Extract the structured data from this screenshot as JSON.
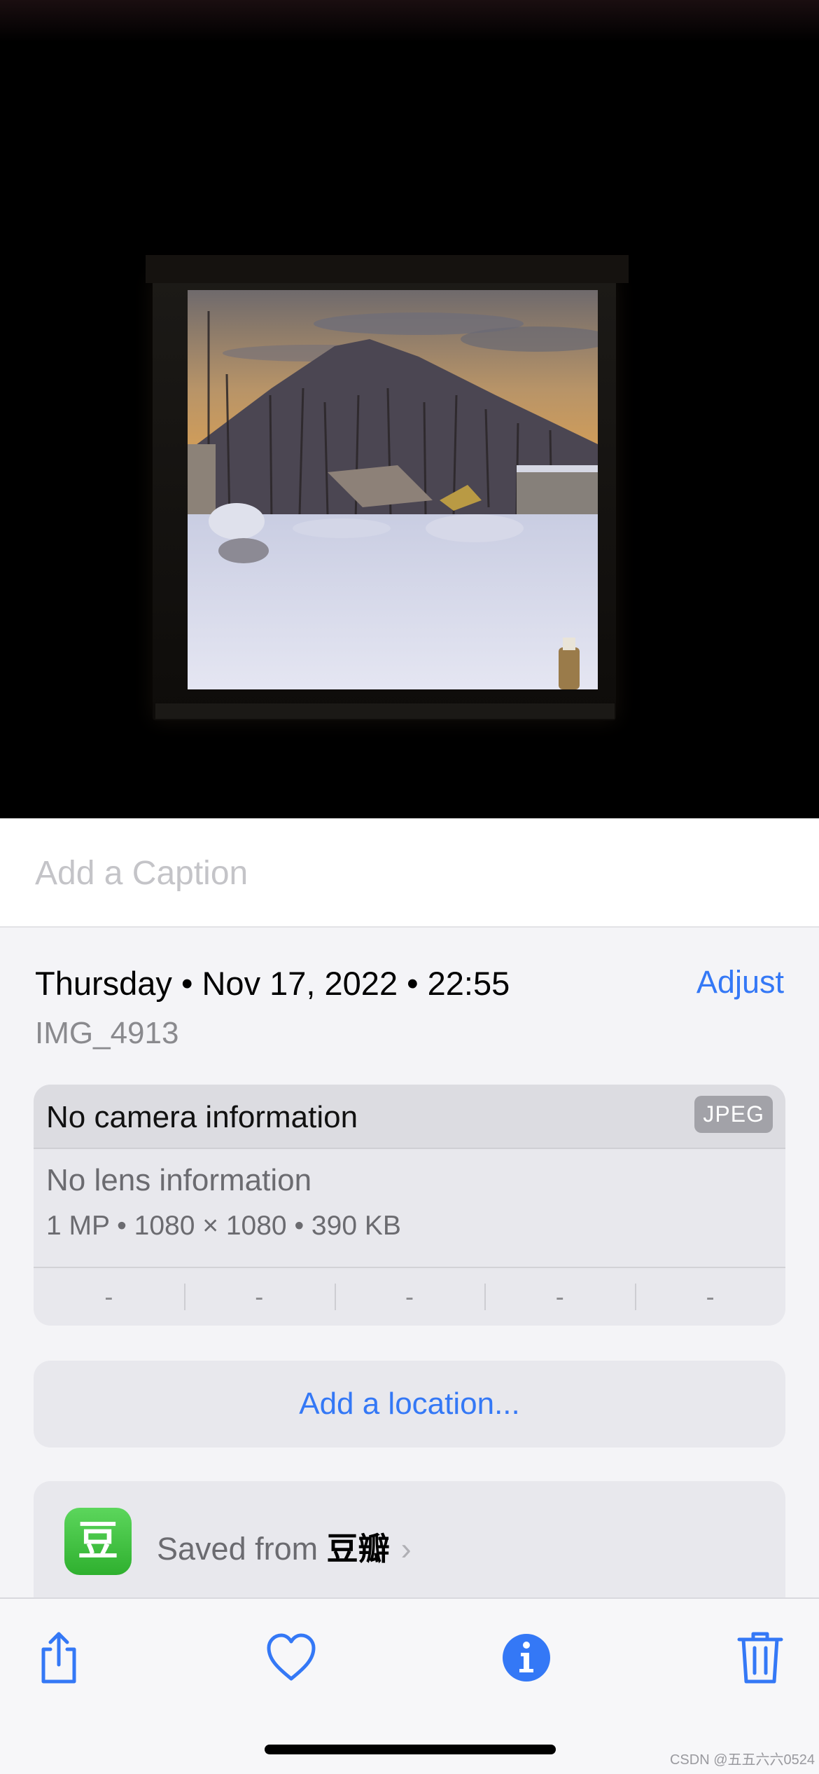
{
  "caption": {
    "placeholder": "Add a Caption"
  },
  "info": {
    "datetime": "Thursday • Nov 17, 2022 • 22:55",
    "adjust_label": "Adjust",
    "filename": "IMG_4913"
  },
  "metadata": {
    "camera": "No camera information",
    "format_badge": "JPEG",
    "lens": "No lens information",
    "specs": "1 MP  •  1080 × 1080  •  390 KB",
    "exif": [
      "-",
      "-",
      "-",
      "-",
      "-"
    ]
  },
  "location": {
    "label": "Add a location..."
  },
  "source": {
    "prefix": "Saved from",
    "app_name": "豆瓣",
    "app_icon_glyph": "豆",
    "chevron": "›"
  },
  "toolbar": {
    "icons": [
      "share-icon",
      "heart-icon",
      "info-icon",
      "trash-icon"
    ]
  },
  "watermark": "CSDN @五五六六0524",
  "colors": {
    "accent": "#3478f6",
    "app_green": "#3dbb3d"
  }
}
